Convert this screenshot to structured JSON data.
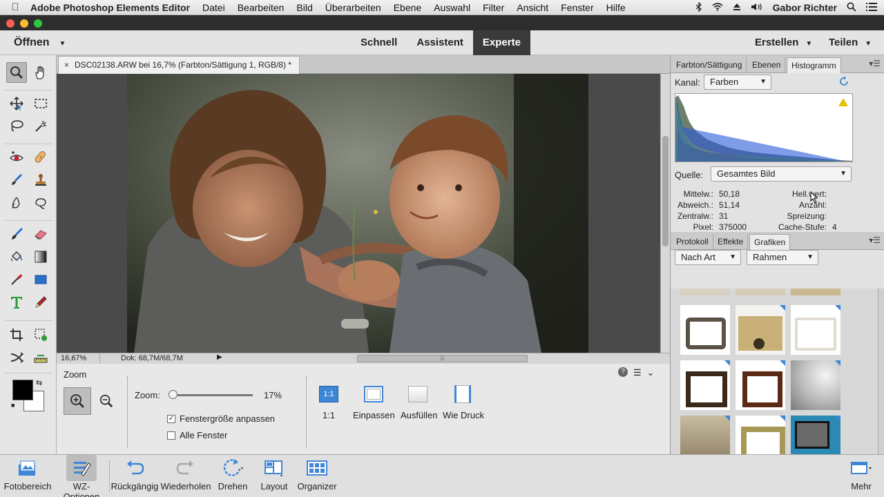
{
  "menubar": {
    "apple": "",
    "app": "Adobe Photoshop Elements Editor",
    "items": [
      "Datei",
      "Bearbeiten",
      "Bild",
      "Überarbeiten",
      "Ebene",
      "Auswahl",
      "Filter",
      "Ansicht",
      "Fenster",
      "Hilfe"
    ],
    "user": "Gabor Richter"
  },
  "topbar": {
    "open_label": "Öffnen",
    "modes": [
      "Schnell",
      "Assistent",
      "Experte"
    ],
    "active_mode": "Experte",
    "create_label": "Erstellen",
    "share_label": "Teilen"
  },
  "document": {
    "tab_close": "×",
    "tab_title": "DSC02138.ARW bei 16,7% (Farbton/Sättigung 1, RGB/8) *"
  },
  "status": {
    "zoom": "16,67%",
    "doc": "Dok: 68,7M/68,7M",
    "arrow": "▶",
    "scroll_grip": "⦙⦙⦙"
  },
  "tool_options": {
    "title": "Zoom",
    "zoom_label": "Zoom:",
    "zoom_value": "17%",
    "zoom_fraction": 0.02,
    "checkbox_fit": "Fenstergröße anpassen",
    "checkbox_fit_checked": true,
    "checkbox_all": "Alle Fenster",
    "checkbox_all_checked": false,
    "view_buttons": [
      {
        "label": "1:1",
        "icon_text": "1:1"
      },
      {
        "label": "Einpassen"
      },
      {
        "label": "Ausfüllen"
      },
      {
        "label": "Wie Druck"
      }
    ],
    "help_icon": "?",
    "menu_icon": "☰",
    "collapse_icon": "⌄"
  },
  "panels": {
    "top_tabs": [
      "Farbton/Sättigung",
      "Ebenen",
      "Histogramm"
    ],
    "top_active": "Histogramm",
    "histogram": {
      "channel_label": "Kanal:",
      "channel_value": "Farben",
      "source_label": "Quelle:",
      "source_value": "Gesamtes Bild",
      "stats_left": [
        {
          "k": "Mittelw.:",
          "v": "50,18"
        },
        {
          "k": "Abweich.:",
          "v": "51,14"
        },
        {
          "k": "Zentralw.:",
          "v": "31"
        },
        {
          "k": "Pixel:",
          "v": "375000"
        }
      ],
      "stats_right": [
        {
          "k": "Hell.wert:",
          "v": ""
        },
        {
          "k": "Anzahl:",
          "v": ""
        },
        {
          "k": "Spreizung:",
          "v": ""
        },
        {
          "k": "Cache-Stufe:",
          "v": "4"
        }
      ]
    },
    "bottom_tabs": [
      "Protokoll",
      "Effekte",
      "Grafiken"
    ],
    "bottom_active": "Grafiken",
    "graphics": {
      "filter1": "Nach Art",
      "filter2": "Rahmen"
    }
  },
  "taskbar": {
    "buttons": [
      "Fotobereich",
      "WZ-Optionen",
      "Rückgängig",
      "Wiederholen",
      "Drehen",
      "Layout",
      "Organizer"
    ],
    "active": "WZ-Optionen",
    "more": "Mehr"
  },
  "colors": {
    "accent_blue": "#2a6fc9",
    "mode_active_bg": "#3a3a3a",
    "foreground_color": "#000000",
    "background_color": "#ffffff"
  }
}
